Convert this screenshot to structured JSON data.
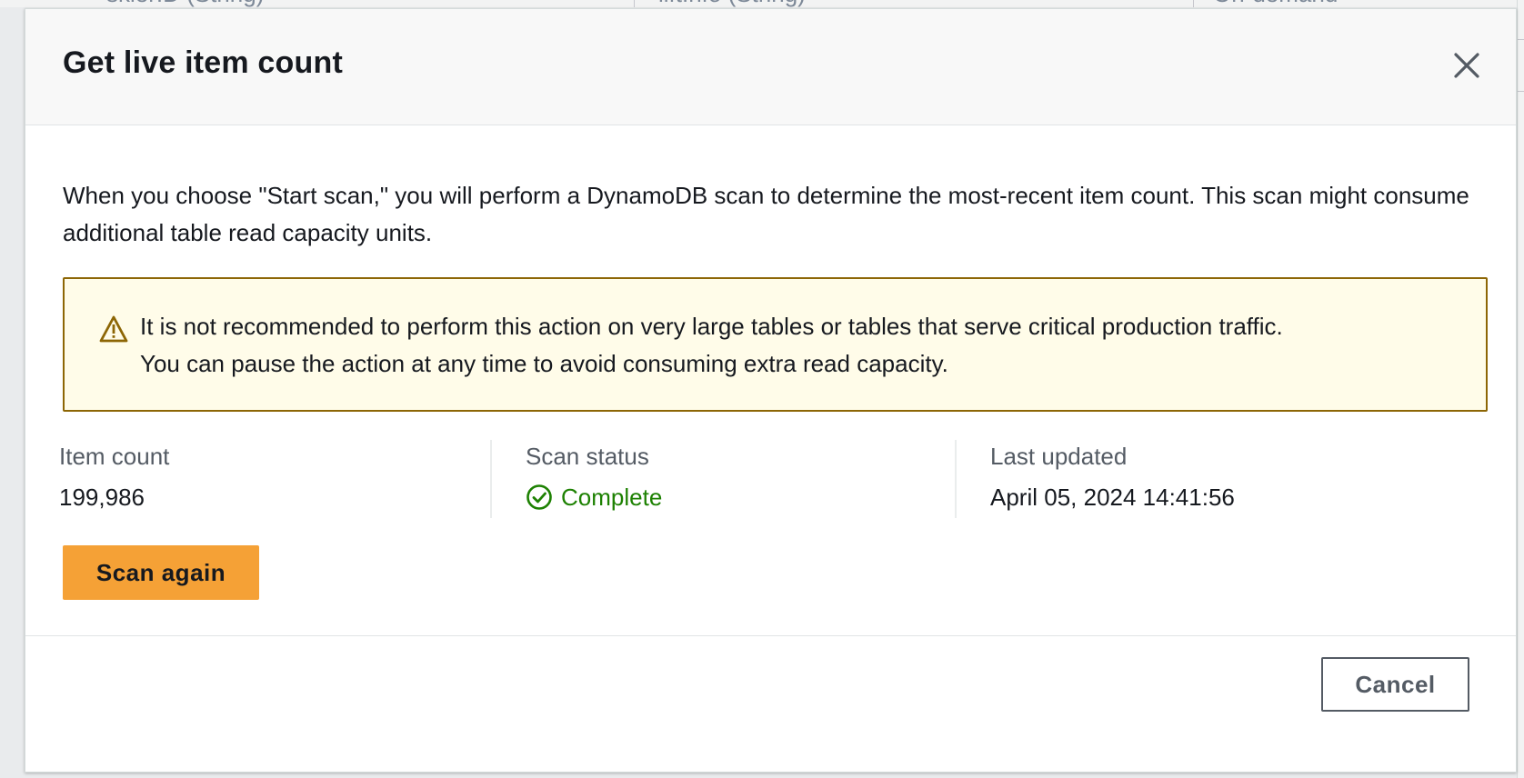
{
  "background": {
    "columns": [
      {
        "label": "skierID (String)"
      },
      {
        "label": "liftInfo (String)"
      },
      {
        "label": "On-demand"
      }
    ]
  },
  "modal": {
    "title": "Get live item count",
    "close_icon": "close-icon",
    "intro": "When you choose \"Start scan,\" you will perform a DynamoDB scan to determine the most-recent item count. This scan might consume additional table read capacity units.",
    "warning": {
      "icon": "warning-triangle-icon",
      "line1": "It is not recommended to perform this action on very large tables or tables that serve critical production traffic.",
      "line2": "You can pause the action at any time to avoid consuming extra read capacity."
    },
    "stats": {
      "item_count_label": "Item count",
      "item_count_value": "199,986",
      "scan_status_label": "Scan status",
      "scan_status_value": "Complete",
      "last_updated_label": "Last updated",
      "last_updated_value": "April 05, 2024 14:41:56"
    },
    "scan_again_label": "Scan again",
    "cancel_label": "Cancel"
  },
  "colors": {
    "primary_button": "#f5a136",
    "success": "#1d8102",
    "warning_border": "#8d6605",
    "warning_bg": "#fffce9"
  }
}
